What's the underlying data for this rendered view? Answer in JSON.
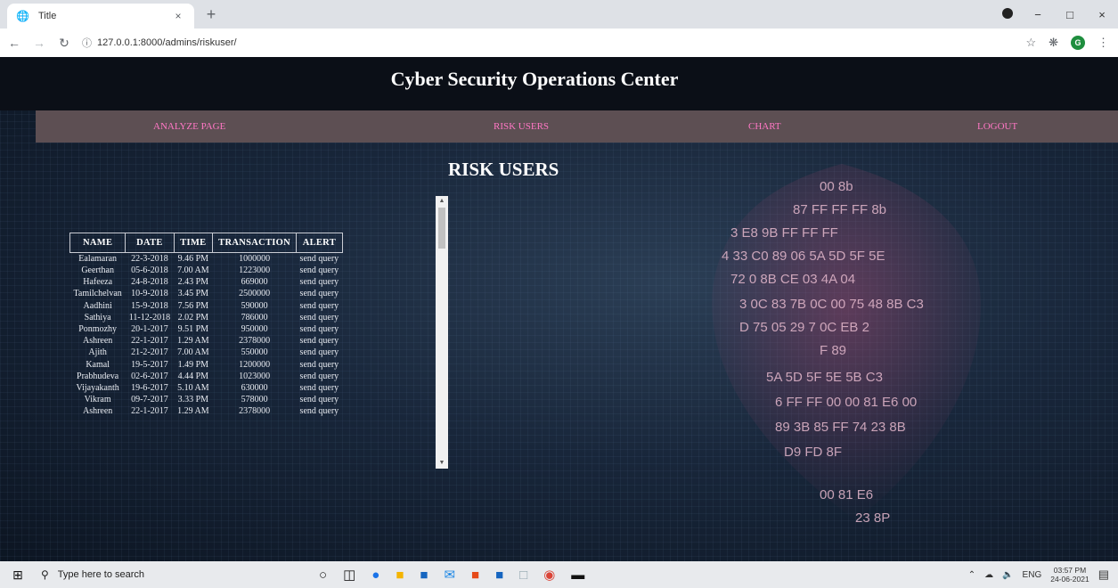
{
  "browser": {
    "tab_title": "Title",
    "tab_close": "×",
    "new_tab": "+",
    "url": "127.0.0.1:8000/admins/riskuser/",
    "window_controls": [
      "−",
      "□",
      "×"
    ],
    "icons": [
      "globe-icon",
      "back-icon",
      "forward-icon",
      "reload-icon",
      "info-icon",
      "star-icon",
      "extensions-icon",
      "profile-icon",
      "menu-icon"
    ],
    "profile_letter": "G"
  },
  "site": {
    "title": "Cyber Security Operations Center",
    "nav": [
      "ANALYZE PAGE",
      "RISK USERS",
      "CHART",
      "LOGOUT"
    ],
    "heading": "RISK USERS",
    "link_color": "#ff77c5",
    "navbar_color": "#5d4f53"
  },
  "table": {
    "columns": [
      "NAME",
      "DATE",
      "TIME",
      "TRANSACTION",
      "ALERT"
    ],
    "rows": [
      [
        "Ealamaran",
        "22-3-2018",
        "9.46 PM",
        "1000000",
        "send query"
      ],
      [
        "Geerthan",
        "05-6-2018",
        "7.00 AM",
        "1223000",
        "send query"
      ],
      [
        "Hafeeza",
        "24-8-2018",
        "2.43 PM",
        "669000",
        "send query"
      ],
      [
        "Tamilchelvan",
        "10-9-2018",
        "3.45 PM",
        "2500000",
        "send query"
      ],
      [
        "Aadhini",
        "15-9-2018",
        "7.56 PM",
        "590000",
        "send query"
      ],
      [
        "Sathiya",
        "11-12-2018",
        "2.02 PM",
        "786000",
        "send query"
      ],
      [
        "Ponmozhy",
        "20-1-2017",
        "9.51 PM",
        "950000",
        "send query"
      ],
      [
        "Ashreen",
        "22-1-2017",
        "1.29 AM",
        "2378000",
        "send query"
      ],
      [
        "Ajith",
        "21-2-2017",
        "7.00 AM",
        "550000",
        "send query"
      ],
      [
        "Kamal",
        "19-5-2017",
        "1.49 PM",
        "1200000",
        "send query"
      ],
      [
        "Prabhudeva",
        "02-6-2017",
        "4.44 PM",
        "1023000",
        "send query"
      ],
      [
        "Vijayakanth",
        "19-6-2017",
        "5.10 AM",
        "630000",
        "send query"
      ],
      [
        "Vikram",
        "09-7-2017",
        "3.33 PM",
        "578000",
        "send query"
      ],
      [
        "Ashreen",
        "22-1-2017",
        "1.29 AM",
        "2378000",
        "send query"
      ]
    ]
  },
  "taskbar": {
    "search_placeholder": "Type here to search",
    "language": "ENG",
    "time": "03:57 PM",
    "date": "24-06-2021",
    "app_icons": [
      "cortana-icon",
      "task-view-icon",
      "edge-icon",
      "file-explorer-icon",
      "store-icon",
      "mail-icon",
      "office-icon",
      "word-icon",
      "notepad-icon",
      "chrome-icon",
      "terminal-icon"
    ]
  }
}
